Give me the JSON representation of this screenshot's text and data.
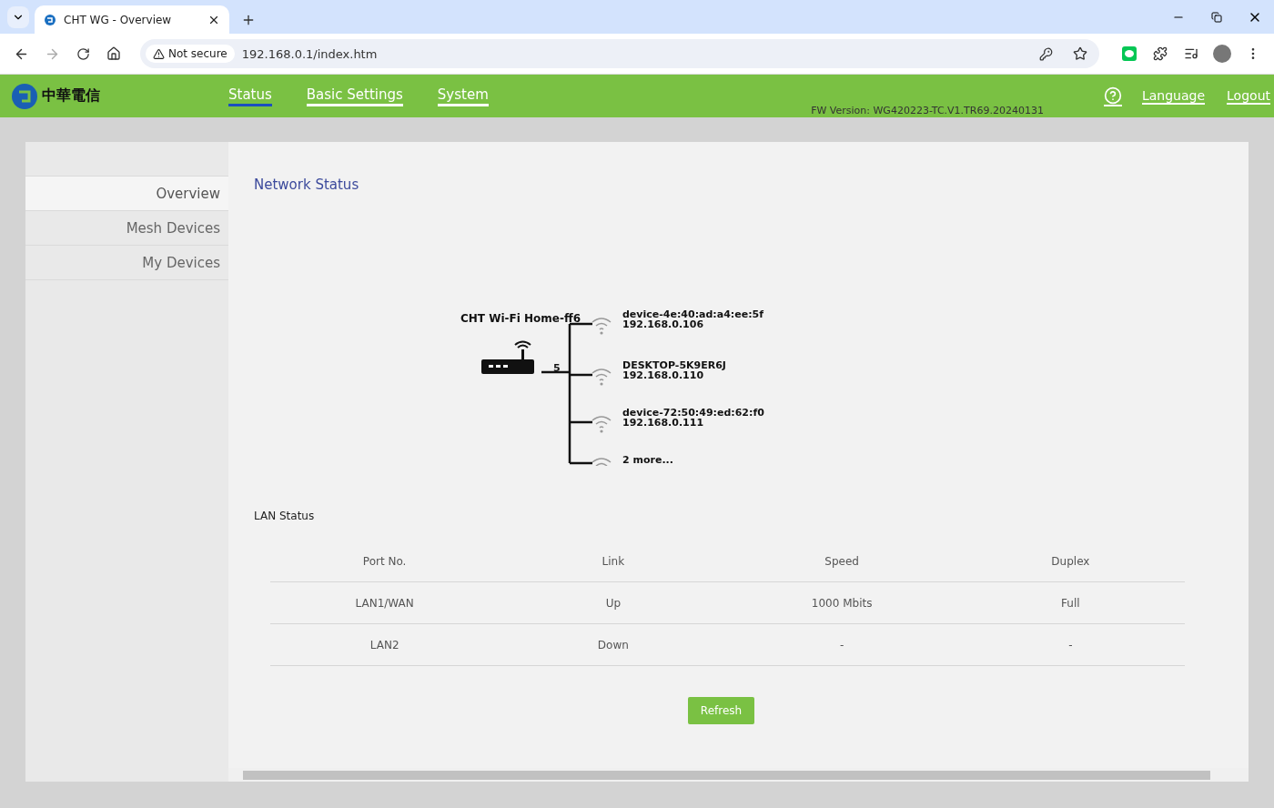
{
  "browser": {
    "tab_title": "CHT WG - Overview",
    "security": "Not secure",
    "url": "192.168.0.1/index.htm"
  },
  "header": {
    "logo_text": "中華電信",
    "nav": [
      {
        "label": "Status",
        "selected": true
      },
      {
        "label": "Basic Settings",
        "selected": false
      },
      {
        "label": "System",
        "selected": false
      }
    ],
    "fw_version": "FW Version: WG420223-TC.V1.TR69.20240131",
    "links": [
      "Language",
      "Logout"
    ]
  },
  "sidebar": {
    "items": [
      {
        "label": "Overview",
        "selected": true
      },
      {
        "label": "Mesh Devices",
        "selected": false
      },
      {
        "label": "My Devices",
        "selected": false
      }
    ]
  },
  "network_status": {
    "title": "Network Status",
    "router_name": "CHT Wi-Fi Home-ff6",
    "client_count": "5",
    "clients": [
      {
        "name": "device-4e:40:ad:a4:ee:5f",
        "ip": "192.168.0.106"
      },
      {
        "name": "DESKTOP-5K9ER6J",
        "ip": "192.168.0.110"
      },
      {
        "name": "device-72:50:49:ed:62:f0",
        "ip": "192.168.0.111"
      },
      {
        "name": "2 more..."
      }
    ]
  },
  "lan_status": {
    "title": "LAN Status",
    "columns": [
      "Port No.",
      "Link",
      "Speed",
      "Duplex"
    ],
    "rows": [
      [
        "LAN1/WAN",
        "Up",
        "1000 Mbits",
        "Full"
      ],
      [
        "LAN2",
        "Down",
        "-",
        "-"
      ]
    ]
  },
  "refresh_button": "Refresh"
}
